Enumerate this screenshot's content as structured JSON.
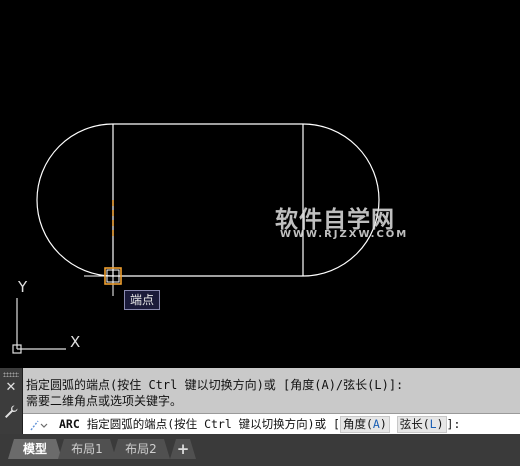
{
  "canvas": {
    "background": "#000000",
    "watermark": {
      "main": "软件自学网",
      "sub": "WWW.RJZXW.COM"
    },
    "snap_tooltip": "端点",
    "ucs": {
      "x_label": "X",
      "y_label": "Y"
    }
  },
  "command": {
    "history": [
      "指定圆弧的端点(按住 Ctrl 键以切换方向)或 [角度(A)/弦长(L)]:",
      "需要二维角点或选项关键字。"
    ],
    "input": {
      "keyword": "ARC",
      "prompt": "指定圆弧的端点(按住 Ctrl 键以切换方向)或 [",
      "options": [
        {
          "label": "角度(",
          "key": "A",
          "suffix": ")"
        },
        {
          "label": "弦长(",
          "key": "L",
          "suffix": ")"
        }
      ],
      "close": "]:"
    },
    "side_icons": {
      "close": "close-icon",
      "settings": "wrench-icon"
    }
  },
  "layout_tabs": {
    "items": [
      {
        "label": "模型",
        "active": true
      },
      {
        "label": "布局1",
        "active": false
      },
      {
        "label": "布局2",
        "active": false
      }
    ],
    "add_label": "+"
  },
  "colors": {
    "geometry": "#ffffff",
    "snap_marker": "#f0a030",
    "command_bg": "#c9c9c9",
    "tabs_bg": "#3a3a3a"
  }
}
